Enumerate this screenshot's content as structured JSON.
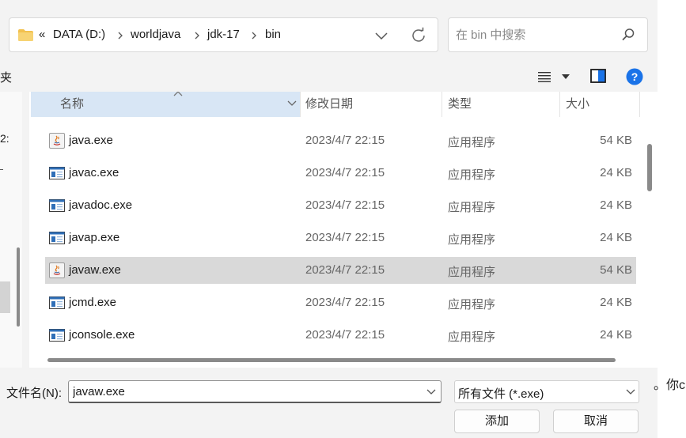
{
  "address_bar": {
    "overflow": "«",
    "crumbs": [
      "DATA (D:)",
      "worldjava",
      "jdk-17",
      "bin"
    ]
  },
  "search": {
    "placeholder": "在 bin 中搜索"
  },
  "toolbar": {
    "left_cut_label": "夹"
  },
  "nav_pane": {
    "cut_text": "2:"
  },
  "columns": {
    "name": "名称",
    "date": "修改日期",
    "type": "类型",
    "size": "大小"
  },
  "files": [
    {
      "name": "java.exe",
      "date": "2023/4/7 22:15",
      "type": "应用程序",
      "size": "54 KB",
      "icon": "java-app-icon",
      "selected": false
    },
    {
      "name": "javac.exe",
      "date": "2023/4/7 22:15",
      "type": "应用程序",
      "size": "24 KB",
      "icon": "executable-icon",
      "selected": false
    },
    {
      "name": "javadoc.exe",
      "date": "2023/4/7 22:15",
      "type": "应用程序",
      "size": "24 KB",
      "icon": "executable-icon",
      "selected": false
    },
    {
      "name": "javap.exe",
      "date": "2023/4/7 22:15",
      "type": "应用程序",
      "size": "24 KB",
      "icon": "executable-icon",
      "selected": false
    },
    {
      "name": "javaw.exe",
      "date": "2023/4/7 22:15",
      "type": "应用程序",
      "size": "54 KB",
      "icon": "java-app-icon",
      "selected": true
    },
    {
      "name": "jcmd.exe",
      "date": "2023/4/7 22:15",
      "type": "应用程序",
      "size": "24 KB",
      "icon": "executable-icon",
      "selected": false
    },
    {
      "name": "jconsole.exe",
      "date": "2023/4/7 22:15",
      "type": "应用程序",
      "size": "24 KB",
      "icon": "executable-icon",
      "selected": false
    }
  ],
  "footer": {
    "filename_label": "文件名(N):",
    "filename_value": "javaw.exe",
    "filetype_value": "所有文件 (*.exe)",
    "open_label": "添加",
    "cancel_label": "取消"
  },
  "background": {
    "right_text": "。你c"
  },
  "colors": {
    "selection": "#d9d9d9",
    "header_highlight": "#d8e6f5",
    "help_blue": "#1a73e8",
    "folder_yellow": "#f2c14e"
  }
}
